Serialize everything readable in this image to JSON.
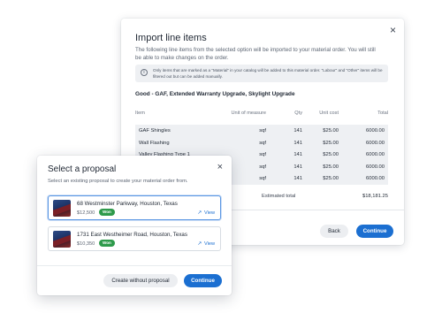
{
  "import_modal": {
    "title": "Import line items",
    "close_glyph": "×",
    "description": "The following line items from the selected option will be imported to your material order. You will still be able to make changes on the order.",
    "notice_icon": "i",
    "notice": "Only items that are marked as a \"Material\" in your catalog will be added to this material order. \"Labour\" and \"Other\" items will be filtered out but can be added manually.",
    "option_title": "Good - GAF, Extended Warranty Upgrade, Skylight Upgrade",
    "columns": {
      "item": "Item",
      "unit_of_measure": "Unit of measure",
      "qty": "Qty",
      "unit_cost": "Unit cost",
      "total": "Total"
    },
    "rows": [
      {
        "item": "GAF Shingles",
        "uom": "sqf",
        "qty": "141",
        "unit_cost": "$25.00",
        "total": "6000.00"
      },
      {
        "item": "Wall Flashing",
        "uom": "sqf",
        "qty": "141",
        "unit_cost": "$25.00",
        "total": "6000.00"
      },
      {
        "item": "Valley Flashing Type 1",
        "uom": "sqf",
        "qty": "141",
        "unit_cost": "$25.00",
        "total": "6000.00"
      },
      {
        "item": "",
        "uom": "sqf",
        "qty": "141",
        "unit_cost": "$25.00",
        "total": "6000.00"
      },
      {
        "item": "",
        "uom": "sqf",
        "qty": "141",
        "unit_cost": "$25.00",
        "total": "6000.00"
      }
    ],
    "estimated_total_label": "Estimated total",
    "estimated_total_value": "$18,181.25",
    "back_label": "Back",
    "continue_label": "Continue"
  },
  "proposal_modal": {
    "title": "Select a proposal",
    "close_glyph": "×",
    "subtitle": "Select an existing proposal to create your material order from.",
    "proposals": [
      {
        "address": "68 Westminster Parkway, Houston, Texas",
        "amount": "$12,500",
        "status": "Won",
        "view_label": "View",
        "view_icon": "↗",
        "selected": true
      },
      {
        "address": "1731 East Westheimer Road, Houston, Texas",
        "amount": "$10,350",
        "status": "Won",
        "view_label": "View",
        "view_icon": "↗",
        "selected": false
      }
    ],
    "create_without_label": "Create without proposal",
    "continue_label": "Continue"
  },
  "colors": {
    "primary": "#1b6fd1",
    "badge_won": "#2e9a4b",
    "table_bg": "#eef0f3"
  },
  "icons": {
    "close": "close-icon",
    "info": "info-icon",
    "external_link": "external-link-icon",
    "house_thumbnail": "house-photo"
  }
}
